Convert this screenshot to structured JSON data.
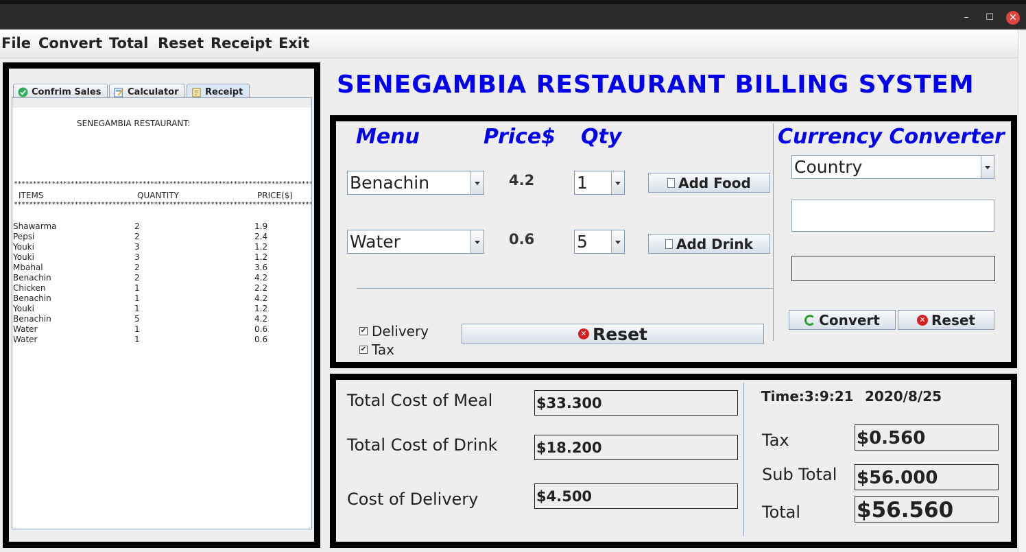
{
  "window": {
    "minimize": "–",
    "maximize": "☐",
    "close": "✕"
  },
  "menu": [
    "File",
    "Convert",
    "Total",
    "Reset",
    "Receipt",
    "Exit"
  ],
  "tabs": [
    {
      "label": "Confrim Sales",
      "icon": "check-circle-icon",
      "active": false
    },
    {
      "label": "Calculator",
      "icon": "calculator-icon",
      "active": false
    },
    {
      "label": "Receipt",
      "icon": "receipt-icon",
      "active": true
    }
  ],
  "receipt": {
    "header": "SENEGAMBIA RESTAURANT:",
    "stars": "*******************************************************************************",
    "columns": [
      "ITEMS",
      "QUANTITY",
      "PRICE($)"
    ],
    "rows": [
      [
        "Shawarma",
        "2",
        "1.9"
      ],
      [
        "Pepsi",
        "2",
        "2.4"
      ],
      [
        "Youki",
        "3",
        "1.2"
      ],
      [
        "Youki",
        "3",
        "1.2"
      ],
      [
        "Mbahal",
        "2",
        "3.6"
      ],
      [
        "Benachin",
        "2",
        "4.2"
      ],
      [
        "Chicken",
        "1",
        "2.2"
      ],
      [
        "Benachin",
        "1",
        "4.2"
      ],
      [
        "Youki",
        "1",
        "1.2"
      ],
      [
        "Benachin",
        "5",
        "4.2"
      ],
      [
        "Water",
        "1",
        "0.6"
      ],
      [
        "Water",
        "1",
        "0.6"
      ]
    ]
  },
  "title": "SENEGAMBIA RESTAURANT BILLING SYSTEM",
  "order": {
    "headers": {
      "menu": "Menu",
      "price": "Price$",
      "qty": "Qty",
      "converter": "Currency Converter"
    },
    "food": {
      "item": "Benachin",
      "price": "4.2",
      "qty": "1",
      "button": "Add Food"
    },
    "drink": {
      "item": "Water",
      "price": "0.6",
      "qty": "5",
      "button": "Add Drink"
    },
    "delivery_label": "Delivery",
    "delivery_checked": true,
    "tax_label": "Tax",
    "tax_checked": true,
    "reset_button": "Reset"
  },
  "converter": {
    "country_selected": "Country",
    "input_value": "",
    "output_value": "",
    "convert_button": "Convert",
    "reset_button": "Reset"
  },
  "totals": {
    "meal_label": "Total Cost of Meal",
    "meal_value": "$33.300",
    "drink_label": "Total Cost of Drink",
    "drink_value": "$18.200",
    "delivery_label": "Cost of Delivery",
    "delivery_value": "$4.500",
    "time": "Time:3:9:21",
    "date": "2020/8/25",
    "tax_label": "Tax",
    "tax_value": "$0.560",
    "subtotal_label": "Sub Total",
    "subtotal_value": "$56.000",
    "total_label": "Total",
    "total_value": "$56.560"
  },
  "colors": {
    "title_blue": "#0000ee",
    "frame": "#000000",
    "background": "#eeeeee"
  }
}
